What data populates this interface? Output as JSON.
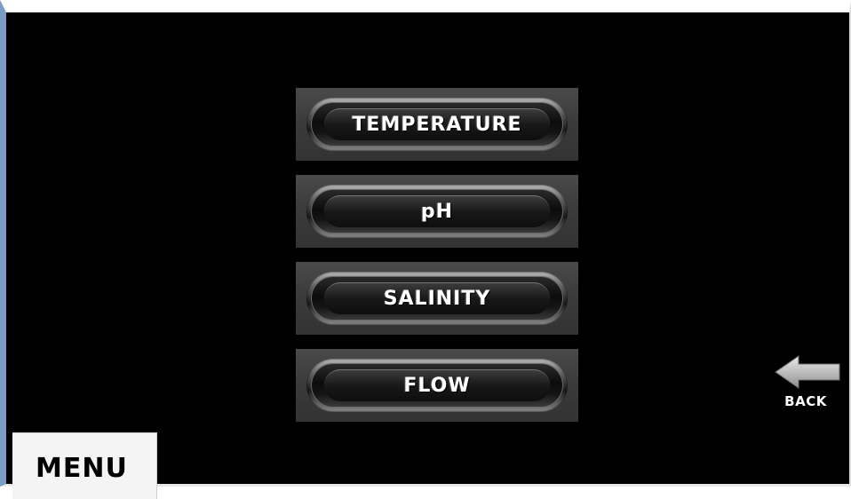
{
  "menu_items": [
    {
      "label": "TEMPERATURE"
    },
    {
      "label": "pH"
    },
    {
      "label": "SALINITY"
    },
    {
      "label": "FLOW"
    }
  ],
  "back": {
    "label": "BACK",
    "icon": "arrow-left-icon"
  },
  "menu": {
    "label": "MENU"
  },
  "colors": {
    "background": "#000000",
    "button_text": "#ffffff",
    "menu_button_bg": "#f4f4f4"
  }
}
